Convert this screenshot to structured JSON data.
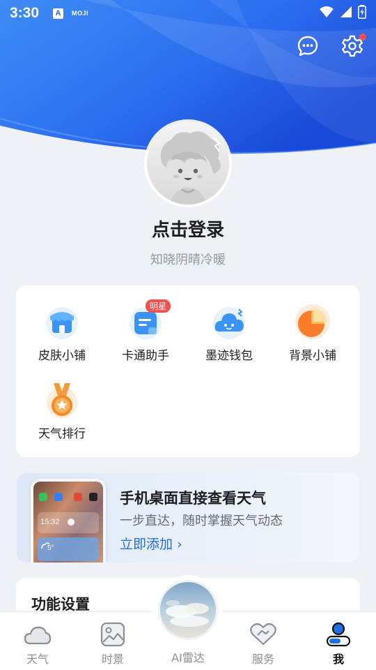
{
  "status_bar": {
    "time": "3:30",
    "app_a": "A",
    "app_moji": "MOJI",
    "icons": [
      "wifi-icon",
      "signal-icon",
      "battery-icon"
    ]
  },
  "header": {
    "icons": [
      "message-icon",
      "settings-icon"
    ],
    "settings_has_notification_dot": true
  },
  "profile": {
    "login_label": "点击登录",
    "tagline": "知晓阴晴冷暖"
  },
  "features": {
    "items": [
      {
        "label": "皮肤小铺",
        "icon": "shop-icon"
      },
      {
        "label": "卡通助手",
        "icon": "assistant-icon",
        "badge": "明星"
      },
      {
        "label": "墨迹钱包",
        "icon": "wallet-icon"
      },
      {
        "label": "背景小铺",
        "icon": "background-shop-icon"
      },
      {
        "label": "天气排行",
        "icon": "medal-icon"
      }
    ]
  },
  "promo": {
    "title": "手机桌面直接查看天气",
    "subtitle": "一步直达，随时掌握天气动态",
    "link": "立即添加 ›",
    "widget_time": "15:32",
    "widget_temp": "5°"
  },
  "function_settings": {
    "title": "功能设置"
  },
  "tabbar": {
    "tabs": [
      {
        "label": "天气",
        "icon": "cloud-icon"
      },
      {
        "label": "时景",
        "icon": "image-icon"
      },
      {
        "label": "AI雷达",
        "icon": "radar-icon"
      },
      {
        "label": "服务",
        "icon": "handshake-icon"
      },
      {
        "label": "我",
        "icon": "profile-icon"
      }
    ],
    "active": "我"
  },
  "colors": {
    "brand_blue": "#1f6fe5",
    "badge_red": "#f2514f",
    "background": "#eef1f5"
  }
}
